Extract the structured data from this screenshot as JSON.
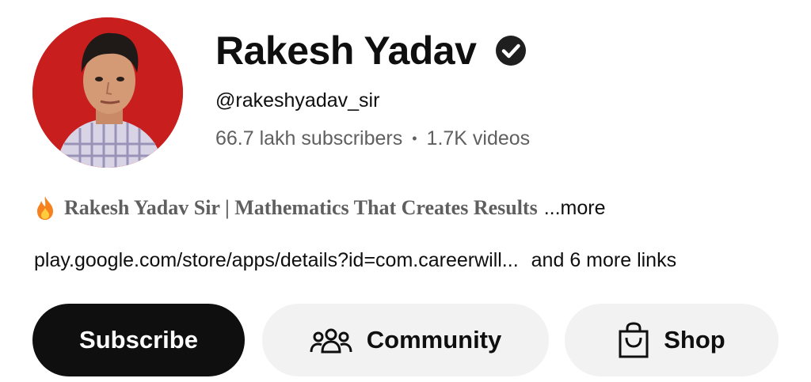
{
  "channel": {
    "name": "Rakesh Yadav",
    "handle": "@rakeshyadav_sir",
    "subscribers": "66.7 lakh subscribers",
    "separator": "•",
    "videos": "1.7K videos",
    "avatar_icon": "channel-avatar-photo",
    "verified_icon": "verified-check-icon"
  },
  "description": {
    "icon": "fire-emoji-icon",
    "text": "Rakesh Yadav Sir | Mathematics That Creates Results",
    "more": "...more"
  },
  "links": {
    "primary": "play.google.com/store/apps/details?id=com.careerwill...",
    "extra": "and 6 more links"
  },
  "actions": {
    "subscribe": "Subscribe",
    "community": "Community",
    "shop": "Shop",
    "community_icon": "people-icon",
    "shop_icon": "shopping-bag-icon"
  },
  "colors": {
    "subscribe_bg": "#0f0f0f",
    "pill_bg": "#f2f2f2",
    "secondary_text": "#606060",
    "avatar_bg": "#c81e1e"
  }
}
